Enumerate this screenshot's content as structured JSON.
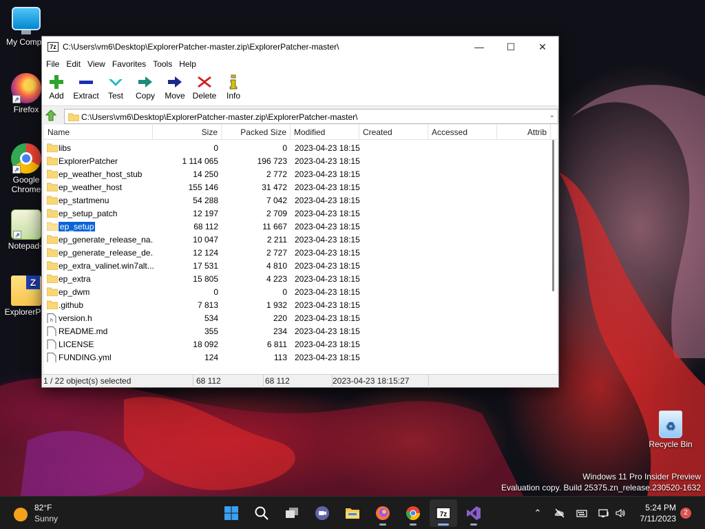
{
  "desktop": {
    "icons": [
      {
        "label": "My Compu"
      },
      {
        "label": "Firefox"
      },
      {
        "label": "Google Chrome"
      },
      {
        "label": "Notepad+"
      },
      {
        "label": "ExplorerPat"
      },
      {
        "label": "Recycle Bin"
      }
    ],
    "watermark": {
      "line1": "Windows 11 Pro Insider Preview",
      "line2": "Evaluation copy. Build 25375.zn_release.230520-1632"
    }
  },
  "window": {
    "app_icon": "7z",
    "title": "C:\\Users\\vm6\\Desktop\\ExplorerPatcher-master.zip\\ExplorerPatcher-master\\",
    "controls": {
      "minimize": "—",
      "maximize": "☐",
      "close": "✕"
    },
    "menu": [
      "File",
      "Edit",
      "View",
      "Favorites",
      "Tools",
      "Help"
    ],
    "toolbar": [
      {
        "label": "Add",
        "icon": "add-icon",
        "color": "#2da52d"
      },
      {
        "label": "Extract",
        "icon": "extract-icon",
        "color": "#1a2fb4"
      },
      {
        "label": "Test",
        "icon": "test-icon",
        "color": "#22b8c8"
      },
      {
        "label": "Copy",
        "icon": "copy-icon",
        "color": "#1e8a7a"
      },
      {
        "label": "Move",
        "icon": "move-icon",
        "color": "#1a2a8a"
      },
      {
        "label": "Delete",
        "icon": "delete-icon",
        "color": "#d02020"
      },
      {
        "label": "Info",
        "icon": "info-icon",
        "color": "#d8c400"
      }
    ],
    "address": "C:\\Users\\vm6\\Desktop\\ExplorerPatcher-master.zip\\ExplorerPatcher-master\\",
    "columns": [
      "Name",
      "Size",
      "Packed Size",
      "Modified",
      "Created",
      "Accessed",
      "Attrib"
    ],
    "files": [
      {
        "name": "libs",
        "size": "0",
        "packed": "0",
        "modified": "2023-04-23 18:15",
        "type": "folder"
      },
      {
        "name": "ExplorerPatcher",
        "size": "1 114 065",
        "packed": "196 723",
        "modified": "2023-04-23 18:15",
        "type": "folder"
      },
      {
        "name": "ep_weather_host_stub",
        "size": "14 250",
        "packed": "2 772",
        "modified": "2023-04-23 18:15",
        "type": "folder"
      },
      {
        "name": "ep_weather_host",
        "size": "155 146",
        "packed": "31 472",
        "modified": "2023-04-23 18:15",
        "type": "folder"
      },
      {
        "name": "ep_startmenu",
        "size": "54 288",
        "packed": "7 042",
        "modified": "2023-04-23 18:15",
        "type": "folder"
      },
      {
        "name": "ep_setup_patch",
        "size": "12 197",
        "packed": "2 709",
        "modified": "2023-04-23 18:15",
        "type": "folder"
      },
      {
        "name": "ep_setup",
        "size": "68 112",
        "packed": "11 667",
        "modified": "2023-04-23 18:15",
        "type": "folder",
        "selected": true
      },
      {
        "name": "ep_generate_release_na...",
        "size": "10 047",
        "packed": "2 211",
        "modified": "2023-04-23 18:15",
        "type": "folder"
      },
      {
        "name": "ep_generate_release_de...",
        "size": "12 124",
        "packed": "2 727",
        "modified": "2023-04-23 18:15",
        "type": "folder"
      },
      {
        "name": "ep_extra_valinet.win7alt...",
        "size": "17 531",
        "packed": "4 810",
        "modified": "2023-04-23 18:15",
        "type": "folder"
      },
      {
        "name": "ep_extra",
        "size": "15 805",
        "packed": "4 223",
        "modified": "2023-04-23 18:15",
        "type": "folder"
      },
      {
        "name": "ep_dwm",
        "size": "0",
        "packed": "0",
        "modified": "2023-04-23 18:15",
        "type": "folder"
      },
      {
        "name": ".github",
        "size": "7 813",
        "packed": "1 932",
        "modified": "2023-04-23 18:15",
        "type": "folder"
      },
      {
        "name": "version.h",
        "size": "534",
        "packed": "220",
        "modified": "2023-04-23 18:15",
        "type": "file-h"
      },
      {
        "name": "README.md",
        "size": "355",
        "packed": "234",
        "modified": "2023-04-23 18:15",
        "type": "file"
      },
      {
        "name": "LICENSE",
        "size": "18 092",
        "packed": "6 811",
        "modified": "2023-04-23 18:15",
        "type": "file"
      },
      {
        "name": "FUNDING.yml",
        "size": "124",
        "packed": "113",
        "modified": "2023-04-23 18:15",
        "type": "file"
      }
    ],
    "status": {
      "selection": "1 / 22 object(s) selected",
      "size": "68 112",
      "packed": "68 112",
      "modified": "2023-04-23 18:15:27"
    }
  },
  "taskbar": {
    "weather": {
      "temp": "82°F",
      "desc": "Sunny"
    },
    "apps": [
      "start-icon",
      "search-icon",
      "task-view-icon",
      "teams-chat-icon",
      "file-explorer-icon",
      "firefox-icon",
      "chrome-icon",
      "7zip-icon",
      "visual-studio-icon"
    ],
    "clock": {
      "time": "5:24 PM",
      "date": "7/11/2023"
    },
    "notifications": "2"
  }
}
